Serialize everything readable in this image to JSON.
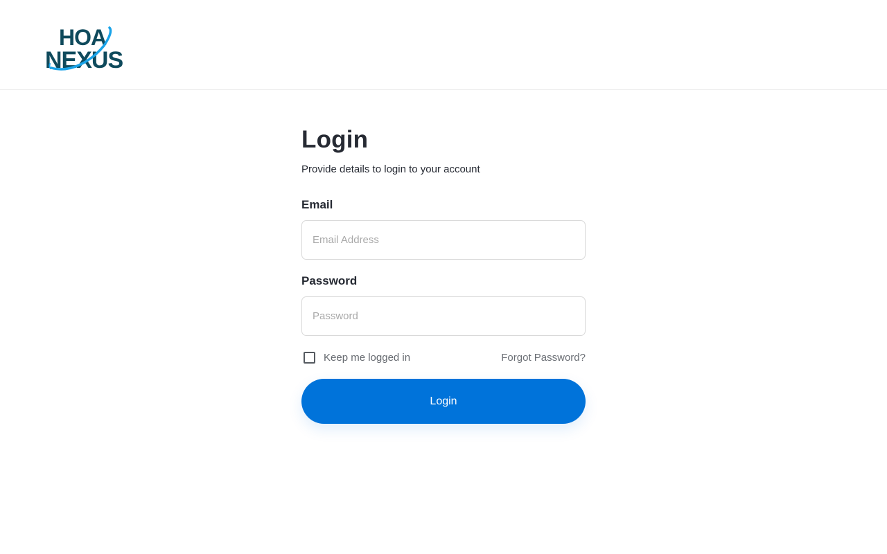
{
  "brand": {
    "logo_line1": "HOA",
    "logo_line2": "NEXUS",
    "logo_dark_color": "#0f4a5c",
    "logo_accent_color": "#1aa3e8"
  },
  "login": {
    "title": "Login",
    "subtitle": "Provide details to login to your account",
    "email_label": "Email",
    "email_placeholder": "Email Address",
    "email_value": "",
    "password_label": "Password",
    "password_placeholder": "Password",
    "password_value": "",
    "keep_logged_in_label": "Keep me logged in",
    "keep_logged_in_checked": false,
    "forgot_password": "Forgot Password?",
    "submit_label": "Login"
  },
  "colors": {
    "primary": "#0073da",
    "text": "#262a33",
    "muted": "#6b6f75",
    "border": "#d9d9d9"
  }
}
